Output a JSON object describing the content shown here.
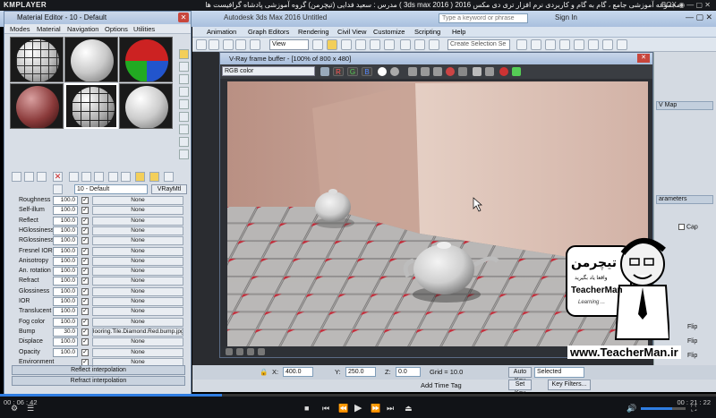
{
  "player": {
    "brand": "KMPLAYER",
    "title": "مجموعه آموزشی جامع ، گام به گام و کاربردی نرم افزار تری دی مکس 2016 ( 3ds max 2016 ) مدرس : سعید فدایی (تیچرمن) گروه آموزشی پادشاه گرافیست ها",
    "controls_right": "BOX ◉ — ▢ ✕",
    "time_elapsed": "00 : 06 : 42",
    "time_total": "00 : 21 : 22",
    "progress_percent": 31
  },
  "max": {
    "window_title": "Autodesk 3ds Max 2016    Untitled",
    "search_placeholder": "Type a keyword or phrase",
    "sign_in": "Sign In",
    "menu": [
      "Animation",
      "Graph Editors",
      "Rendering",
      "Civil View",
      "Customize",
      "Scripting",
      "Help"
    ],
    "view_dropdown": "View",
    "create_selection": "Create Selection Se",
    "right_panel": {
      "header1": "V Map",
      "header2": "arameters",
      "cap": "Cap",
      "flip1": "Flip",
      "flip2": "Flip",
      "flip3": "Flip"
    },
    "timeline": {
      "x_label": "X:",
      "x": "400.0",
      "y_label": "Y:",
      "y": "250.0",
      "z_label": "Z:",
      "z": "0.0",
      "grid": "Grid = 10.0",
      "auto_key": "Auto Key",
      "selected": "Selected",
      "set_key": "Set Key",
      "key_filters": "Key Filters...",
      "add_time_tag": "Add Time Tag"
    }
  },
  "material_editor": {
    "title": "Material Editor - 10 - Default",
    "menu": [
      "Modes",
      "Material",
      "Navigation",
      "Options",
      "Utilities"
    ],
    "material_name": "10 - Default",
    "material_type": "VRayMtl",
    "map_rows": [
      {
        "label": "Roughness",
        "value": "100.0",
        "checked": true,
        "map": "None"
      },
      {
        "label": "Self-illum",
        "value": "100.0",
        "checked": true,
        "map": "None"
      },
      {
        "label": "Reflect",
        "value": "100.0",
        "checked": true,
        "map": "None"
      },
      {
        "label": "HGlossiness",
        "value": "100.0",
        "checked": true,
        "map": "None"
      },
      {
        "label": "RGlossiness",
        "value": "100.0",
        "checked": true,
        "map": "None"
      },
      {
        "label": "Fresnel IOR",
        "value": "100.0",
        "checked": true,
        "map": "None"
      },
      {
        "label": "Anisotropy",
        "value": "100.0",
        "checked": true,
        "map": "None"
      },
      {
        "label": "An. rotation",
        "value": "100.0",
        "checked": true,
        "map": "None"
      },
      {
        "label": "Refract",
        "value": "100.0",
        "checked": true,
        "map": "None"
      },
      {
        "label": "Glossiness",
        "value": "100.0",
        "checked": true,
        "map": "None"
      },
      {
        "label": "IOR",
        "value": "100.0",
        "checked": true,
        "map": "None"
      },
      {
        "label": "Translucent",
        "value": "100.0",
        "checked": true,
        "map": "None"
      },
      {
        "label": "Fog color",
        "value": "100.0",
        "checked": true,
        "map": "None"
      },
      {
        "label": "Bump",
        "value": "30.0",
        "checked": true,
        "map": "looring.Tile.Diamond.Red.bump.jpg)"
      },
      {
        "label": "Displace",
        "value": "100.0",
        "checked": true,
        "map": "None"
      },
      {
        "label": "Opacity",
        "value": "100.0",
        "checked": true,
        "map": "None"
      },
      {
        "label": "Environment",
        "value": "",
        "checked": true,
        "map": "None"
      }
    ],
    "rollouts": [
      "Reflect interpolation",
      "Refract interpolation"
    ]
  },
  "vfb": {
    "title": "V-Ray frame buffer - [100% of 800 x 480]",
    "channel": "RGB color",
    "buttons": [
      "R",
      "G",
      "B"
    ]
  },
  "watermark": {
    "brand_fa": "تیچرمن",
    "tagline_fa": "واقعا یاد بگیرید",
    "name": "TeacherMan",
    "slogan": "Learning ...",
    "url": "www.TeacherMan.ir"
  },
  "colors": {
    "accent_blue": "#2f7de1",
    "red_tile": "#c81e2e",
    "wall": "#c9a89a"
  }
}
